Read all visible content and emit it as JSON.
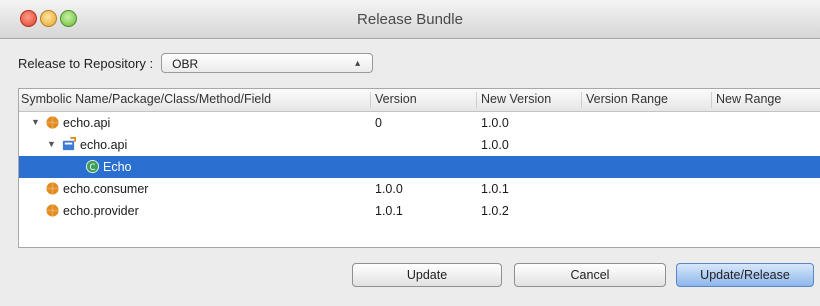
{
  "window": {
    "title": "Release Bundle"
  },
  "repository": {
    "label": "Release to Repository :",
    "selected": "OBR"
  },
  "table": {
    "columns": [
      "Symbolic Name/Package/Class/Method/Field",
      "Version",
      "New Version",
      "Version Range",
      "New Range"
    ],
    "rows": [
      {
        "name": "echo.api",
        "version": "0",
        "new_version": "1.0.0",
        "icon": "bundle-icon",
        "expanded": true
      },
      {
        "name": "echo.api",
        "version": "",
        "new_version": "1.0.0",
        "icon": "package-icon",
        "expanded": true
      },
      {
        "name": "Echo",
        "version": "",
        "new_version": "",
        "icon": "class-icon",
        "selected": true
      },
      {
        "name": "echo.consumer",
        "version": "1.0.0",
        "new_version": "1.0.1",
        "icon": "bundle-icon"
      },
      {
        "name": "echo.provider",
        "version": "1.0.1",
        "new_version": "1.0.2",
        "icon": "bundle-icon"
      }
    ]
  },
  "buttons": {
    "update": "Update",
    "cancel": "Cancel",
    "update_release": "Update/Release"
  },
  "colors": {
    "selection": "#2b6fd0",
    "bundle": "#e38a1c",
    "package": "#3d7bd6",
    "class": "#3fa05a"
  }
}
